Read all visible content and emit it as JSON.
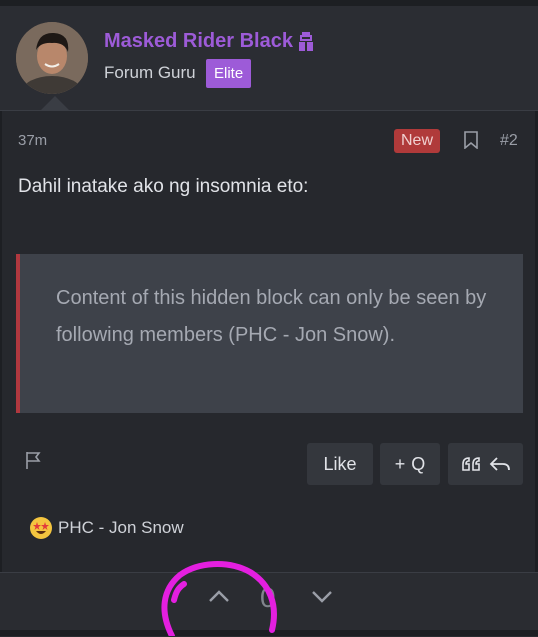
{
  "post": {
    "author": {
      "name": "Masked Rider Black",
      "title": "Forum Guru",
      "badge": "Elite",
      "icon": "ninja-icon"
    },
    "time": "37m",
    "new_label": "New",
    "number": "#2",
    "message": "Dahil inatake ako ng insomnia eto:",
    "hidden_block": "Content of this hidden block can only be seen by following members (PHC - Jon Snow)."
  },
  "actions": {
    "like": "Like",
    "quote": "Q",
    "quote_plus": "+"
  },
  "reaction": {
    "emoji": "star-struck-emoji",
    "user": "PHC - Jon Snow"
  },
  "votes": {
    "count": "0"
  },
  "colors": {
    "accent": "#9d5bd8",
    "new_badge": "#b03a3a",
    "hidden_border": "#b0383f",
    "annotation": "#e41fe0"
  }
}
